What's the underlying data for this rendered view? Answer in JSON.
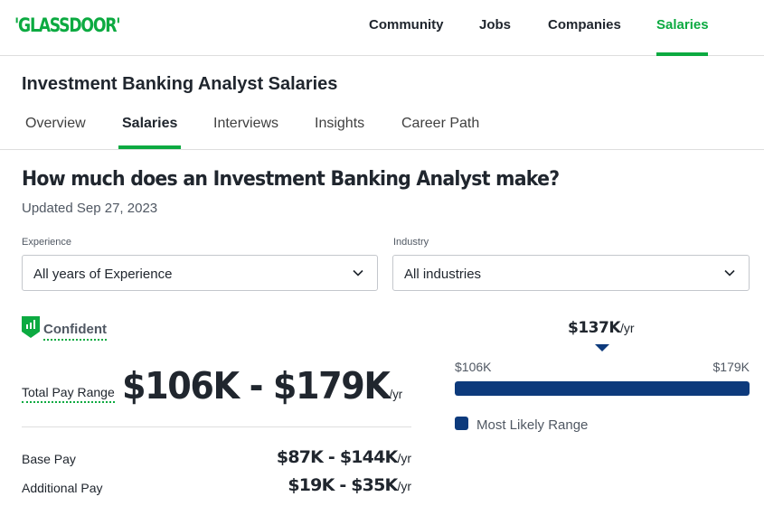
{
  "header": {
    "logo": "'GLASSDOOR'",
    "nav": [
      {
        "label": "Community",
        "active": false
      },
      {
        "label": "Jobs",
        "active": false
      },
      {
        "label": "Companies",
        "active": false
      },
      {
        "label": "Salaries",
        "active": true
      }
    ]
  },
  "subheader": {
    "title": "Investment Banking Analyst Salaries",
    "tabs": [
      {
        "label": "Overview",
        "active": false
      },
      {
        "label": "Salaries",
        "active": true
      },
      {
        "label": "Interviews",
        "active": false
      },
      {
        "label": "Insights",
        "active": false
      },
      {
        "label": "Career Path",
        "active": false
      }
    ]
  },
  "main": {
    "heading": "How much does an Investment Banking Analyst make?",
    "updated": "Updated Sep 27, 2023",
    "filters": {
      "experience": {
        "label": "Experience",
        "value": "All years of Experience",
        "icon": "chevron-down-icon"
      },
      "industry": {
        "label": "Industry",
        "value": "All industries",
        "icon": "chevron-down-icon"
      }
    },
    "confidence": {
      "label": "Confident",
      "icon": "bar-chart-shield-icon"
    },
    "total_pay": {
      "label": "Total Pay Range",
      "value": "$106K - $179K",
      "unit": "/yr"
    },
    "base_pay": {
      "label": "Base Pay",
      "value": "$87K - $144K",
      "unit": "/yr"
    },
    "additional_pay": {
      "label": "Additional Pay",
      "value": "$19K - $35K",
      "unit": "/yr"
    },
    "range_chart": {
      "median": "$137K",
      "median_unit": "/yr",
      "min_label": "$106K",
      "max_label": "$179K",
      "min_value": 106,
      "max_value": 179,
      "median_value": 137,
      "likely_range_start_fraction": 0.0,
      "likely_range_end_fraction": 1.0,
      "legend": "Most Likely Range"
    }
  },
  "colors": {
    "brand_green": "#0caa41",
    "range_navy": "#0d3a7c",
    "text_dark": "#20262e",
    "text_muted": "#505863"
  }
}
